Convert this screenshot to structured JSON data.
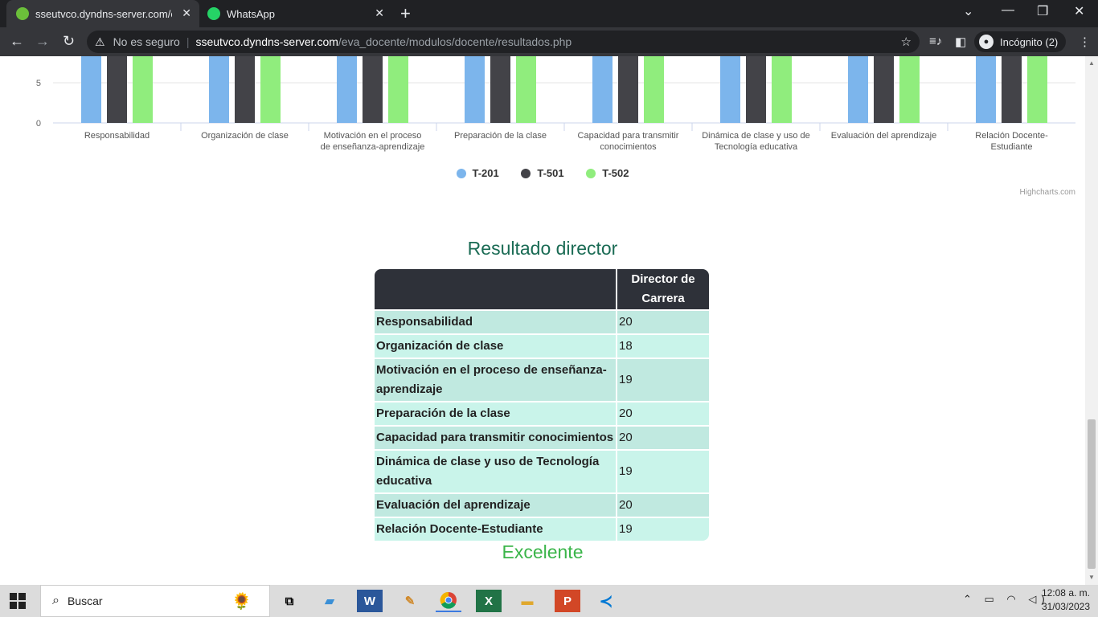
{
  "browser": {
    "tabs": [
      {
        "title": "sseutvco.dyndns-server.com/eva_docente",
        "active": true
      },
      {
        "title": "WhatsApp",
        "active": false
      }
    ],
    "address": {
      "security_label": "No es seguro",
      "host": "sseutvco.dyndns-server.com",
      "path": "/eva_docente/modulos/docente/resultados.php"
    },
    "profile_label": "Incógnito (2)"
  },
  "chart_data": {
    "type": "bar",
    "categories": [
      "Responsabilidad",
      "Organización de clase",
      "Motivación en el proceso de enseñanza-aprendizaje",
      "Preparación de la clase",
      "Capacidad para transmitir conocimientos",
      "Dinámica de clase y uso de Tecnología educativa",
      "Evaluación del aprendizaje",
      "Relación Docente-Estudiante"
    ],
    "category_lines": [
      [
        "Responsabilidad"
      ],
      [
        "Organización de clase"
      ],
      [
        "Motivación en el proceso",
        "de enseñanza-aprendizaje"
      ],
      [
        "Preparación de la clase"
      ],
      [
        "Capacidad para transmitir",
        "conocimientos"
      ],
      [
        "Dinámica de clase y uso de",
        "Tecnología educativa"
      ],
      [
        "Evaluación del aprendizaje"
      ],
      [
        "Relación Docente-",
        "Estudiante"
      ]
    ],
    "series": [
      {
        "name": "T-201",
        "color": "#7cb5ec"
      },
      {
        "name": "T-501",
        "color": "#434348"
      },
      {
        "name": "T-502",
        "color": "#90ed7d"
      }
    ],
    "visible_y_ticks": [
      "5",
      "0"
    ],
    "bars_extend_above_view": true,
    "credits": "Highcharts.com",
    "legend_position": "bottom-center"
  },
  "section_title": "Resultado director",
  "table": {
    "header": [
      "",
      "Director de Carrera"
    ],
    "rows": [
      {
        "label": "Responsabilidad",
        "value": "20"
      },
      {
        "label": "Organización de clase",
        "value": "18"
      },
      {
        "label": "Motivación en el proceso de enseñanza-aprendizaje",
        "value": "19"
      },
      {
        "label": "Preparación de la clase",
        "value": "20"
      },
      {
        "label": "Capacidad para transmitir conocimientos",
        "value": "20"
      },
      {
        "label": "Dinámica de clase y uso de Tecnología educativa",
        "value": "19"
      },
      {
        "label": "Evaluación del aprendizaje",
        "value": "20"
      },
      {
        "label": "Relación Docente-Estudiante",
        "value": "19"
      }
    ]
  },
  "verdict": "Excelente",
  "taskbar": {
    "search_placeholder": "Buscar",
    "time": "12:08 a. m.",
    "date": "31/03/2023"
  }
}
